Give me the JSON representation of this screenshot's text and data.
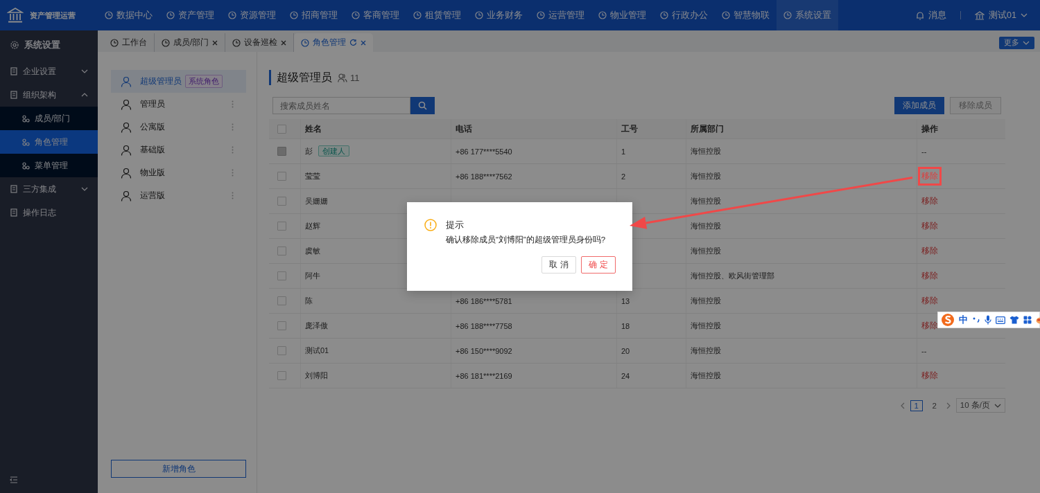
{
  "app": {
    "title": "资产管理运营"
  },
  "top_nav": [
    {
      "label": "数据中心",
      "selected": false
    },
    {
      "label": "资产管理",
      "selected": false
    },
    {
      "label": "资源管理",
      "selected": false
    },
    {
      "label": "招商管理",
      "selected": false
    },
    {
      "label": "客商管理",
      "selected": false
    },
    {
      "label": "租赁管理",
      "selected": false
    },
    {
      "label": "业务财务",
      "selected": false
    },
    {
      "label": "运营管理",
      "selected": false
    },
    {
      "label": "物业管理",
      "selected": false
    },
    {
      "label": "行政办公",
      "selected": false
    },
    {
      "label": "智慧物联",
      "selected": false
    },
    {
      "label": "系统设置",
      "selected": true
    }
  ],
  "header_right": {
    "notifications": "消息",
    "user": "测试01"
  },
  "tabs": [
    {
      "label": "工作台",
      "selected": false,
      "closable": false
    },
    {
      "label": "成员/部门",
      "selected": false,
      "closable": true
    },
    {
      "label": "设备巡检",
      "selected": false,
      "closable": true
    },
    {
      "label": "角色管理",
      "selected": true,
      "closable": true
    }
  ],
  "more_button": "更多",
  "sidebar": {
    "title": "系统设置",
    "items": [
      {
        "label": "企业设置",
        "kind": "group",
        "expanded": false
      },
      {
        "label": "组织架构",
        "kind": "group",
        "expanded": true,
        "children": [
          {
            "label": "成员/部门",
            "selected": false
          },
          {
            "label": "角色管理",
            "selected": true
          },
          {
            "label": "菜单管理",
            "selected": false
          }
        ]
      },
      {
        "label": "三方集成",
        "kind": "group",
        "expanded": false
      },
      {
        "label": "操作日志",
        "kind": "item"
      }
    ]
  },
  "roles": [
    {
      "name": "超级管理员",
      "selected": true,
      "tag": "系统角色"
    },
    {
      "name": "管理员",
      "selected": false
    },
    {
      "name": "公寓版",
      "selected": false
    },
    {
      "name": "基础版",
      "selected": false
    },
    {
      "name": "物业版",
      "selected": false
    },
    {
      "name": "运营版",
      "selected": false
    }
  ],
  "add_role_button": "新增角色",
  "members": {
    "title": "超级管理员",
    "count": "11",
    "search_placeholder": "搜索成员姓名",
    "add_button": "添加成员",
    "remove_button": {
      "label": "移除成员",
      "disabled": true
    }
  },
  "table": {
    "select_all_checked": false,
    "columns": [
      "姓名",
      "电话",
      "工号",
      "所属部门",
      "操作"
    ],
    "rows": [
      {
        "checked": false,
        "disabled": true,
        "name": "彭",
        "tag": "创建人",
        "phone": "+86 177****5540",
        "number": "1",
        "department": "海恒控股",
        "action": "--",
        "removable": false,
        "highlighted": false
      },
      {
        "checked": false,
        "disabled": false,
        "name": "莹莹",
        "phone": "+86 188****7562",
        "number": "2",
        "department": "海恒控股",
        "action": "移除",
        "removable": true,
        "highlighted": true
      },
      {
        "checked": false,
        "disabled": false,
        "name": "吴姗姗",
        "department": "海恒控股",
        "action": "移除",
        "removable": true,
        "highlighted": false
      },
      {
        "checked": false,
        "disabled": false,
        "name": "赵辉",
        "department": "海恒控股",
        "action": "移除",
        "removable": true,
        "highlighted": false
      },
      {
        "checked": false,
        "disabled": false,
        "name": "虞敏",
        "department": "海恒控股",
        "action": "移除",
        "removable": true,
        "highlighted": false
      },
      {
        "checked": false,
        "disabled": false,
        "name": "阿牛",
        "department": "海恒控股、欧风街管理部",
        "action": "移除",
        "removable": true,
        "highlighted": false
      },
      {
        "checked": false,
        "disabled": false,
        "name": "陈",
        "phone": "+86 186****5781",
        "number": "13",
        "department": "海恒控股",
        "action": "移除",
        "removable": true,
        "highlighted": false
      },
      {
        "checked": false,
        "disabled": false,
        "name": "庞泽傲",
        "phone": "+86 188****7758",
        "number": "18",
        "department": "海恒控股",
        "action": "移除",
        "removable": true,
        "highlighted": false
      },
      {
        "checked": false,
        "disabled": false,
        "name": "测试01",
        "phone": "+86 150****9092",
        "number": "20",
        "department": "海恒控股",
        "action": "--",
        "removable": false,
        "highlighted": false
      },
      {
        "checked": false,
        "disabled": false,
        "name": "刘博阳",
        "phone": "+86 181****2169",
        "number": "24",
        "department": "海恒控股",
        "action": "移除",
        "removable": true,
        "highlighted": false
      }
    ]
  },
  "pagination": {
    "pages": [
      {
        "label": "1",
        "selected": true
      },
      {
        "label": "2",
        "selected": false
      }
    ],
    "page_size": "10 条/页"
  },
  "dialog": {
    "title": "提示",
    "message": "确认移除成员“刘博阳”的超级管理员身份吗?",
    "buttons": [
      {
        "label": "取 消",
        "kind": "default"
      },
      {
        "label": "确 定",
        "kind": "danger"
      }
    ]
  },
  "ime": {
    "label": "中"
  }
}
